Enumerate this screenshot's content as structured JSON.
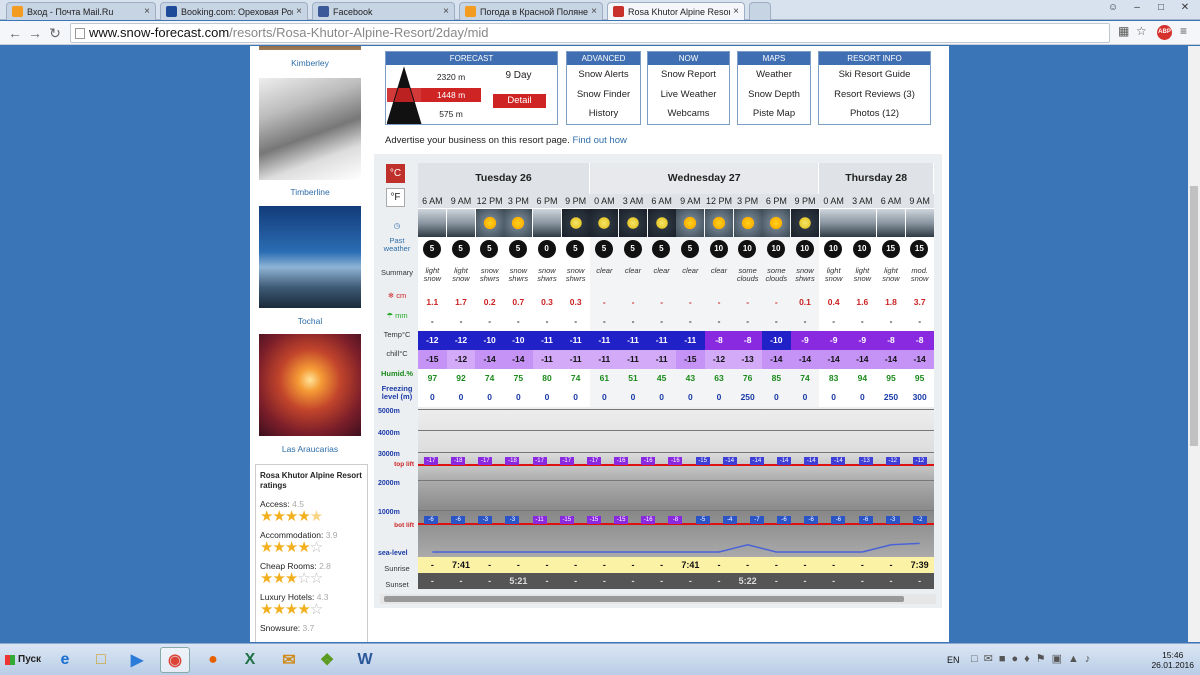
{
  "browser": {
    "tabs": [
      {
        "label": "Вход - Почта Mail.Ru",
        "color": "#f39c1f"
      },
      {
        "label": "Booking.com: Ореховая Роща",
        "color": "#1d4b9a"
      },
      {
        "label": "Facebook",
        "color": "#3b5998"
      },
      {
        "label": "Погода в Красной Поляне - ...",
        "color": "#f39c1f"
      },
      {
        "label": "Rosa Khutor Alpine Resort Do",
        "color": "#c7302b"
      }
    ],
    "url_host": "www.snow-forecast.com",
    "url_path": "/resorts/Rosa-Khutor-Alpine-Resort/2day/mid",
    "abp": "ABP"
  },
  "sidebar": {
    "photos": [
      {
        "label": "Kimberley"
      },
      {
        "label": "Timberline"
      },
      {
        "label": "Tochal"
      },
      {
        "label": "Las Araucarias"
      }
    ],
    "ratings_title": "Rosa Khutor Alpine Resort ratings",
    "ratings": [
      {
        "label": "Access:",
        "value": "4.5",
        "stars": "★★★★",
        "half": "★",
        "off": ""
      },
      {
        "label": "Accommodation:",
        "value": "3.9",
        "stars": "★★★★",
        "half": "",
        "off": "☆"
      },
      {
        "label": "Cheap Rooms:",
        "value": "2.8",
        "stars": "★★★",
        "half": "",
        "off": "☆☆"
      },
      {
        "label": "Luxury Hotels:",
        "value": "4.3",
        "stars": "★★★★",
        "half": "",
        "off": "☆"
      },
      {
        "label": "Snowsure:",
        "value": "3.7",
        "stars": "",
        "half": "",
        "off": ""
      }
    ]
  },
  "nav": {
    "forecast": {
      "title": "FORECAST",
      "elevations": [
        "2320 m",
        "1448 m",
        "575 m"
      ],
      "nine_day": "9 Day",
      "detail": "Detail"
    },
    "boxes": [
      {
        "title": "ADVANCED",
        "items": [
          "Snow Alerts",
          "Snow Finder",
          "History"
        ]
      },
      {
        "title": "NOW",
        "items": [
          "Snow Report",
          "Live Weather",
          "Webcams"
        ]
      },
      {
        "title": "MAPS",
        "items": [
          "Weather",
          "Snow Depth",
          "Piste Map"
        ]
      },
      {
        "title": "RESORT INFO",
        "items": [
          "Ski Resort Guide",
          "Resort Reviews (3)",
          "Photos (12)"
        ]
      }
    ],
    "advert_text": "Advertise your business on this resort page.",
    "advert_link": "Find out how"
  },
  "forecast": {
    "unit_c": "°C",
    "unit_f": "°F",
    "days": [
      {
        "label": "Tuesday 26",
        "span": 6
      },
      {
        "label": "Wednesday 27",
        "span": 8
      },
      {
        "label": "Thursday 28",
        "span": 4
      }
    ],
    "times": [
      "6 AM",
      "9 AM",
      "12 PM",
      "3 PM",
      "6 PM",
      "9 PM",
      "0 AM",
      "3 AM",
      "6 AM",
      "9 AM",
      "12 PM",
      "3 PM",
      "6 PM",
      "9 PM",
      "0 AM",
      "3 AM",
      "6 AM",
      "9 AM"
    ],
    "icons": [
      "snow",
      "snow",
      "sun-snow",
      "sun-snow",
      "cloud-night",
      "moon-snow",
      "moon",
      "moon",
      "moon",
      "sun",
      "sun",
      "sun-cloud",
      "sun-cloud",
      "moon-snow",
      "snow-night",
      "snow-night",
      "snow",
      "snow"
    ],
    "wind": [
      "5",
      "5",
      "5",
      "5",
      "0",
      "5",
      "5",
      "5",
      "5",
      "5",
      "10",
      "10",
      "10",
      "10",
      "10",
      "10",
      "15",
      "15"
    ],
    "summary": [
      "light snow",
      "light snow",
      "snow shwrs",
      "snow shwrs",
      "snow shwrs",
      "snow shwrs",
      "clear",
      "clear",
      "clear",
      "clear",
      "clear",
      "some clouds",
      "some clouds",
      "snow shwrs",
      "light snow",
      "light snow",
      "light snow",
      "mod. snow"
    ],
    "row_labels": {
      "past": "Past weather",
      "summary": "Summary",
      "snow": "cm",
      "rain": "mm",
      "temp": "Temp°C",
      "chill": "chill°C",
      "humid": "Humid.%",
      "freezing": "Freezing level (m)",
      "alt5000": "5000m",
      "alt4000": "4000m",
      "alt3000": "3000m",
      "top": "top lift",
      "alt2000": "2000m",
      "alt1000": "1000m",
      "bot": "bot lift",
      "sea": "sea-level",
      "sunrise": "Sunrise",
      "sunset": "Sunset"
    },
    "snow": [
      "1.1",
      "1.7",
      "0.2",
      "0.7",
      "0.3",
      "0.3",
      "-",
      "-",
      "-",
      "-",
      "-",
      "-",
      "-",
      "0.1",
      "0.4",
      "1.6",
      "1.8",
      "3.7"
    ],
    "rain": [
      "-",
      "-",
      "-",
      "-",
      "-",
      "-",
      "-",
      "-",
      "-",
      "-",
      "-",
      "-",
      "-",
      "-",
      "-",
      "-",
      "-",
      "-"
    ],
    "temp": [
      "-12",
      "-12",
      "-10",
      "-10",
      "-11",
      "-11",
      "-11",
      "-11",
      "-11",
      "-11",
      "-8",
      "-8",
      "-10",
      "-9",
      "-9",
      "-9",
      "-8",
      "-8"
    ],
    "chill": [
      "-15",
      "-12",
      "-14",
      "-14",
      "-11",
      "-11",
      "-11",
      "-11",
      "-11",
      "-15",
      "-12",
      "-13",
      "-14",
      "-14",
      "-14",
      "-14",
      "-14",
      "-14"
    ],
    "humid": [
      "97",
      "92",
      "74",
      "75",
      "80",
      "74",
      "61",
      "51",
      "45",
      "43",
      "63",
      "76",
      "85",
      "74",
      "83",
      "94",
      "95",
      "95"
    ],
    "freezing": [
      "0",
      "0",
      "0",
      "0",
      "0",
      "0",
      "0",
      "0",
      "0",
      "0",
      "0",
      "250",
      "0",
      "0",
      "0",
      "0",
      "250",
      "300"
    ],
    "top_lift": [
      "-17",
      "-18",
      "-17",
      "-18",
      "-17",
      "-17",
      "-17",
      "-16",
      "-16",
      "-16",
      "-15",
      "-14",
      "-14",
      "-14",
      "-14",
      "-14",
      "-13",
      "-12",
      "-12"
    ],
    "bot_lift": [
      "-6",
      "-6",
      "-3",
      "-3",
      "-11",
      "-15",
      "-15",
      "-15",
      "-16",
      "-8",
      "-5",
      "-4",
      "-7",
      "-6",
      "-6",
      "-6",
      "-6",
      "-3",
      "-2"
    ],
    "sunrise": [
      "-",
      "7:41",
      "-",
      "-",
      "-",
      "-",
      "-",
      "-",
      "-",
      "7:41",
      "-",
      "-",
      "-",
      "-",
      "-",
      "-",
      "-",
      "7:39"
    ],
    "sunset": [
      "-",
      "-",
      "-",
      "5:21",
      "-",
      "-",
      "-",
      "-",
      "-",
      "-",
      "-",
      "5:22",
      "-",
      "-",
      "-",
      "-",
      "-",
      "-"
    ]
  },
  "taskbar": {
    "start": "Пуск",
    "lang": "EN",
    "time": "15:46",
    "date": "26.01.2016"
  }
}
